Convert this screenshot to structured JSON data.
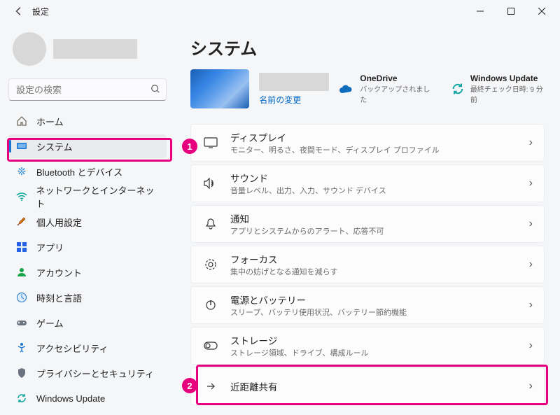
{
  "window": {
    "title": "設定"
  },
  "search": {
    "placeholder": "設定の検索"
  },
  "sidebar": {
    "items": [
      {
        "label": "ホーム"
      },
      {
        "label": "システム"
      },
      {
        "label": "Bluetooth とデバイス"
      },
      {
        "label": "ネットワークとインターネット"
      },
      {
        "label": "個人用設定"
      },
      {
        "label": "アプリ"
      },
      {
        "label": "アカウント"
      },
      {
        "label": "時刻と言語"
      },
      {
        "label": "ゲーム"
      },
      {
        "label": "アクセシビリティ"
      },
      {
        "label": "プライバシーとセキュリティ"
      },
      {
        "label": "Windows Update"
      }
    ]
  },
  "page": {
    "title": "システム",
    "rename": "名前の変更",
    "onedrive": {
      "title": "OneDrive",
      "sub": "バックアップされました"
    },
    "update": {
      "title": "Windows Update",
      "sub": "最終チェック日時: 9 分前"
    }
  },
  "cards": [
    {
      "title": "ディスプレイ",
      "sub": "モニター、明るさ、夜間モード、ディスプレイ プロファイル"
    },
    {
      "title": "サウンド",
      "sub": "音量レベル、出力、入力、サウンド デバイス"
    },
    {
      "title": "通知",
      "sub": "アプリとシステムからのアラート、応答不可"
    },
    {
      "title": "フォーカス",
      "sub": "集中の妨げとなる通知を減らす"
    },
    {
      "title": "電源とバッテリー",
      "sub": "スリープ、バッテリ使用状況、バッテリー節約機能"
    },
    {
      "title": "ストレージ",
      "sub": "ストレージ領域、ドライブ、構成ルール"
    },
    {
      "title": "近距離共有",
      "sub": ""
    }
  ],
  "annotations": {
    "1": "1",
    "2": "2"
  }
}
